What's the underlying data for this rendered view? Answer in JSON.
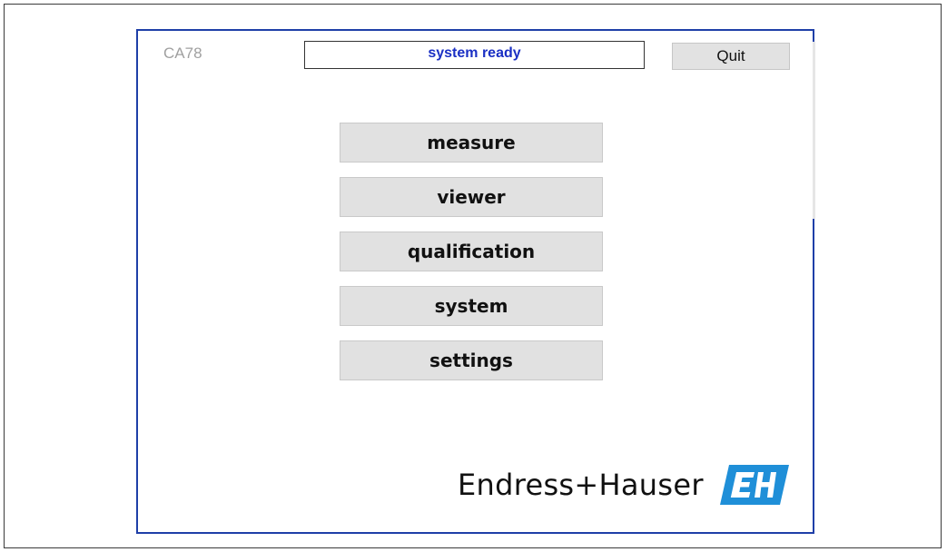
{
  "header": {
    "device_id": "CA78",
    "status": "system ready",
    "quit_label": "Quit"
  },
  "menu": {
    "items": [
      {
        "label": "measure"
      },
      {
        "label": "viewer"
      },
      {
        "label": "qualification"
      },
      {
        "label": "system"
      },
      {
        "label": "settings"
      }
    ]
  },
  "brand": {
    "name": "Endress+Hauser",
    "logo_text": "EH",
    "logo_color": "#1f8fd8"
  },
  "colors": {
    "frame_border": "#1f3fa8",
    "status_text": "#1a2fc4",
    "button_face": "#e1e1e1"
  }
}
